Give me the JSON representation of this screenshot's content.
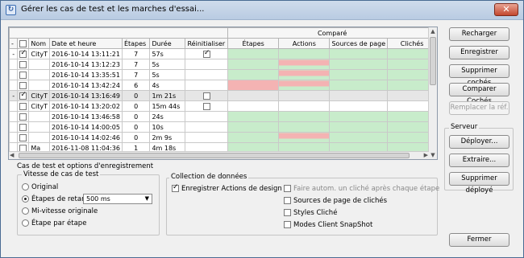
{
  "window": {
    "title": "Gérer les cas de test et les marches d'essai...",
    "close_label": "✕"
  },
  "grid": {
    "group_header": "Comparé",
    "columns": [
      "-",
      "",
      "Nom",
      "Date et heure",
      "Étapes",
      "Durée",
      "Réinitialiser",
      "Étapes",
      "Actions",
      "Sources de page",
      "Clichés"
    ],
    "rows": [
      {
        "exp": "-",
        "chk": true,
        "name": "CityT",
        "date": "2016-10-14 13:11:21",
        "steps": "7",
        "dur": "57s",
        "reset": true,
        "group": true
      },
      {
        "exp": "",
        "chk": false,
        "name": "",
        "date": "2016-10-14 13:12:23",
        "steps": "7",
        "dur": "5s",
        "reset": false
      },
      {
        "exp": "",
        "chk": false,
        "name": "",
        "date": "2016-10-14 13:35:51",
        "steps": "7",
        "dur": "5s",
        "reset": false
      },
      {
        "exp": "",
        "chk": false,
        "name": "",
        "date": "2016-10-14 13:42:24",
        "steps": "6",
        "dur": "4s",
        "reset": false
      },
      {
        "exp": "-",
        "chk": true,
        "name": "CityT",
        "date": "2016-10-14 13:16:49",
        "steps": "0",
        "dur": "1m 21s",
        "reset": false,
        "group": true,
        "selected": true
      },
      {
        "exp": "",
        "chk": false,
        "name": "CityT",
        "date": "2016-10-14 13:20:02",
        "steps": "0",
        "dur": "15m 44s",
        "reset": false,
        "group": true
      },
      {
        "exp": "",
        "chk": false,
        "name": "",
        "date": "2016-10-14 13:46:58",
        "steps": "0",
        "dur": "24s",
        "reset": false
      },
      {
        "exp": "",
        "chk": false,
        "name": "",
        "date": "2016-10-14 14:00:05",
        "steps": "0",
        "dur": "10s",
        "reset": false
      },
      {
        "exp": "",
        "chk": false,
        "name": "",
        "date": "2016-10-14 14:02:46",
        "steps": "0",
        "dur": "2m 9s",
        "reset": false
      },
      {
        "exp": "",
        "chk": false,
        "name": "Ma",
        "date": "2016-11-08 11:04:36",
        "steps": "1",
        "dur": "4m 18s",
        "reset": false
      }
    ]
  },
  "buttons": {
    "reload": "Recharger",
    "save": "Enregistrer",
    "delete_checked": "Supprimer cochés",
    "compare_checked": "Comparer Cochés",
    "replace_ref": "Remplacer la réf.",
    "deploy": "Déployer...",
    "extract": "Extraire...",
    "delete_deployed": "Supprimer déployé",
    "close": "Fermer"
  },
  "server": {
    "label": "Serveur"
  },
  "options": {
    "section_label": "Cas de test et options d'enregistrement",
    "speed_group": "Vitesse de cas de test",
    "speed": {
      "original": "Original",
      "delayed": "Étapes de retard",
      "half": "Mi-vitesse originale",
      "step": "Étape par étape"
    },
    "delay_value": "500 ms",
    "collection_group": "Collection de données",
    "collect": {
      "record_actions": "Enregistrer Actions de design",
      "auto_snapshot": "Faire autom. un cliché après chaque étape",
      "page_sources": "Sources de page de clichés",
      "snapshot_styles": "Styles Cliché",
      "client_modes": "Modes Client SnapShot"
    }
  }
}
